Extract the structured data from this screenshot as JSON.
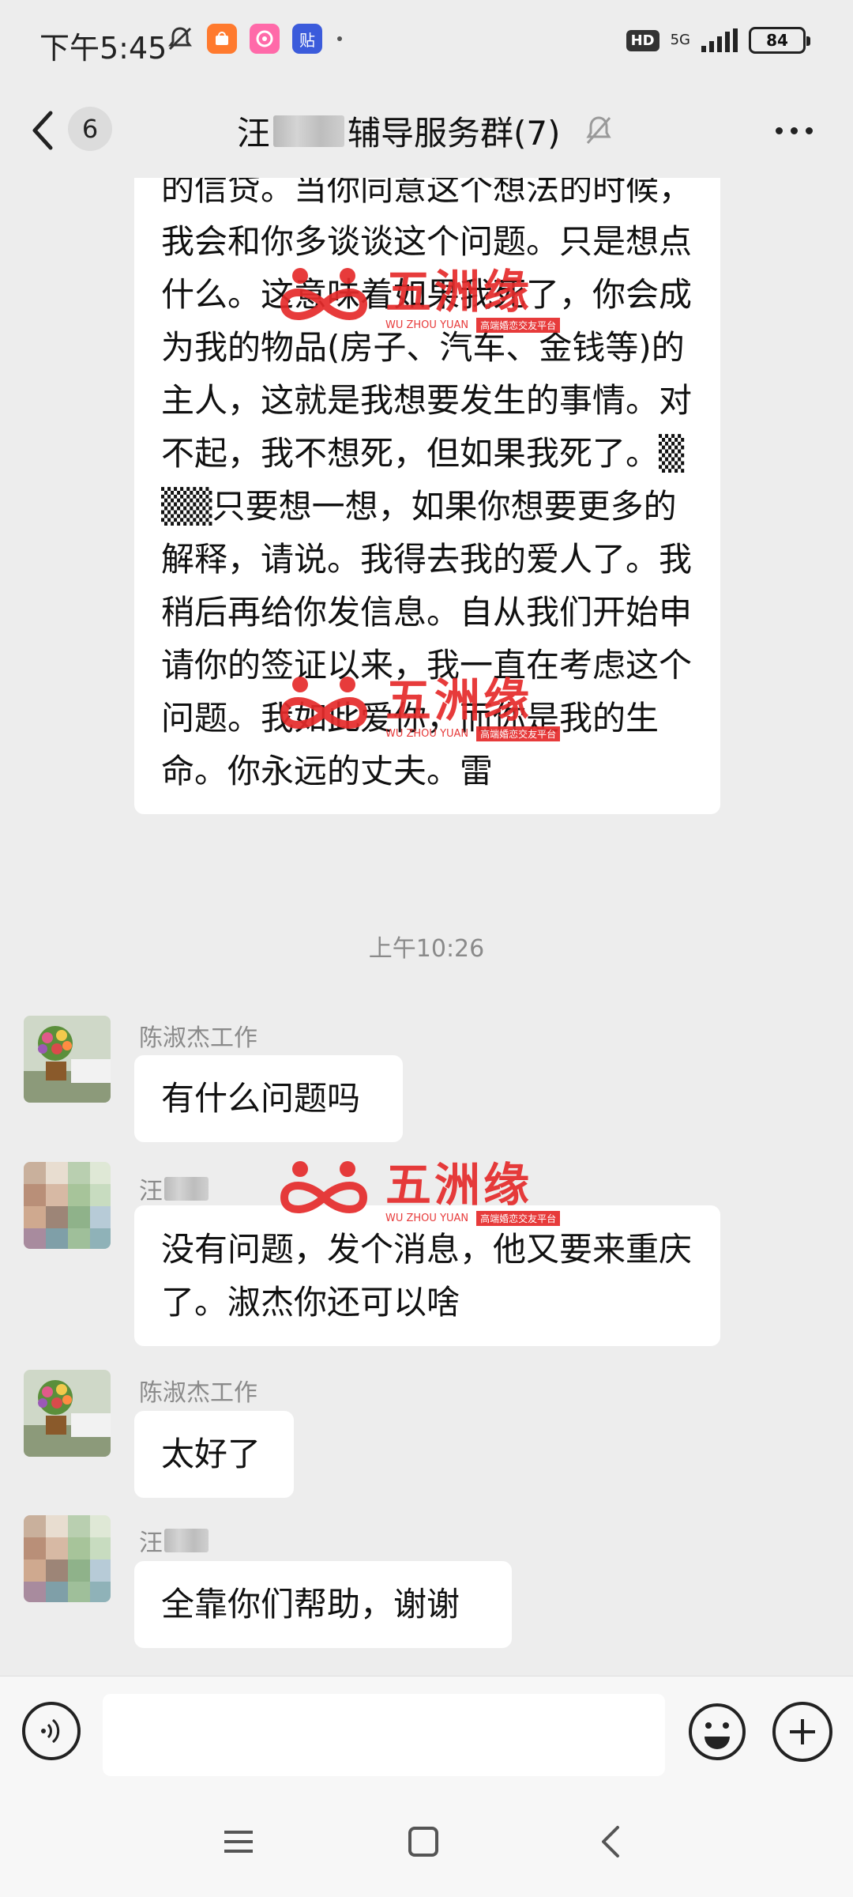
{
  "status_bar": {
    "time": "下午5:45",
    "network": "5G",
    "hd": "HD",
    "battery": "84",
    "app_badge_tie": "贴"
  },
  "header": {
    "unread_count": "6",
    "title_prefix": "汪",
    "title_suffix": "辅导服务群(7)"
  },
  "messages": {
    "long_text": "的信贷。当你同意这个想法的时候，我会和你多谈谈这个问题。只是想点什么。这意味着如果我死了，你会成为我的物品(房子、汽车、金钱等)的主人，这就是我想要发生的事情。对不起，我不想死，但如果我死了。▒▒▒只要想一想，如果你想要更多的解释，请说。我得去我的爱人了。我稍后再给你发信息。自从我们开始申请你的签证以来，我一直在考虑这个问题。我如此爱你，而你是我的生命。你永远的丈夫。雷",
    "timestamp": "上午10:26",
    "items": [
      {
        "sender": "陈淑杰工作",
        "text": "有什么问题吗"
      },
      {
        "sender": "汪",
        "text": "没有问题，发个消息，他又要来重庆了。淑杰你还可以啥"
      },
      {
        "sender": "陈淑杰工作",
        "text": "太好了"
      },
      {
        "sender": "汪",
        "text": "全靠你们帮助，谢谢"
      }
    ]
  },
  "watermark": {
    "brand": "五洲缘",
    "pinyin": "WU ZHOU YUAN",
    "tagline": "高端婚恋交友平台",
    "color": "#e52b2b"
  }
}
